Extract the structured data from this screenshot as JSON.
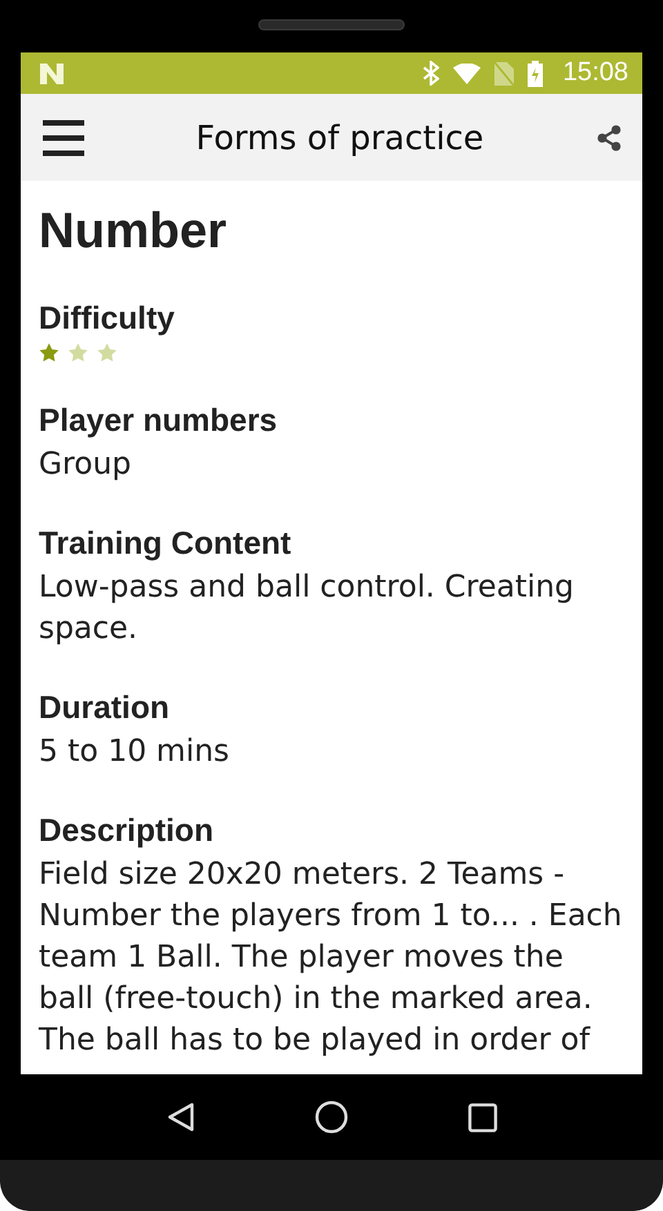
{
  "status_bar": {
    "time": "15:08"
  },
  "app_bar": {
    "title": "Forms of practice"
  },
  "page": {
    "title": "Number",
    "sections": [
      {
        "kind": "stars",
        "heading": "Difficulty",
        "stars": 1
      },
      {
        "kind": "text",
        "heading": "Player numbers",
        "text": "Group"
      },
      {
        "kind": "text",
        "heading": "Training Content",
        "text": "Low-pass and ball control. Creating space."
      },
      {
        "kind": "text",
        "heading": "Duration",
        "text": "5 to 10 mins"
      },
      {
        "kind": "text",
        "heading": "Description",
        "text": "Field size 20x20 meters. 2 Teams - Number the players from 1 to... . Each team 1 Ball. The player moves the ball (free-touch) in the marked area. The ball has to be played in order of"
      }
    ]
  }
}
